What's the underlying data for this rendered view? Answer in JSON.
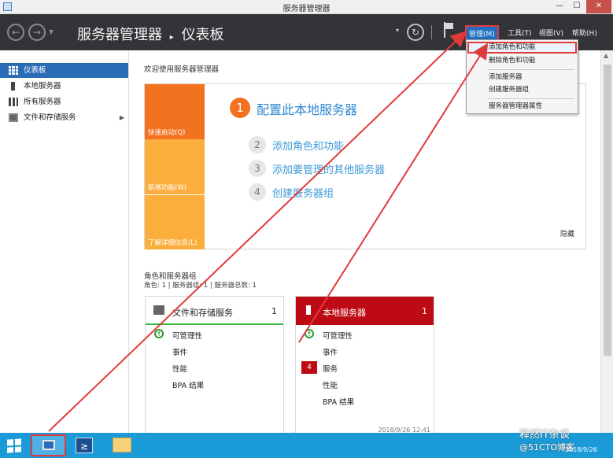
{
  "window": {
    "title": "服务器管理器",
    "minimize": "—",
    "maximize": "☐",
    "close": "✕"
  },
  "header": {
    "breadcrumb_root": "服务器管理器",
    "breadcrumb_sep": "▸",
    "breadcrumb_page": "仪表板",
    "menu": {
      "manage": "管理(M)",
      "tools": "工具(T)",
      "view": "视图(V)",
      "help": "帮助(H)"
    }
  },
  "sidebar": {
    "items": [
      {
        "label": "仪表板",
        "icon": "dashboard-icon",
        "active": true
      },
      {
        "label": "本地服务器",
        "icon": "server-icon"
      },
      {
        "label": "所有服务器",
        "icon": "servers-icon"
      },
      {
        "label": "文件和存储服务",
        "icon": "storage-icon",
        "expand": "▶"
      }
    ]
  },
  "welcome": {
    "title": "欢迎使用服务器管理器",
    "tiles": [
      "快速启动(Q)",
      "新增功能(W)",
      "了解详细信息(L)"
    ],
    "steps": [
      {
        "num": "1",
        "text": "配置此本地服务器"
      },
      {
        "num": "2",
        "text": "添加角色和功能"
      },
      {
        "num": "3",
        "text": "添加要管理的其他服务器"
      },
      {
        "num": "4",
        "text": "创建服务器组"
      }
    ],
    "hide": "隐藏"
  },
  "roles": {
    "title": "角色和服务器组",
    "subtitle": "角色: 1 | 服务器组: 1 | 服务器总数: 1",
    "cards": [
      {
        "name": "文件和存储服务",
        "count": "1",
        "rows": [
          "可管理性",
          "事件",
          "性能",
          "BPA 结果"
        ]
      },
      {
        "name": "本地服务器",
        "count": "1",
        "rows": [
          "可管理性",
          "事件",
          "服务",
          "性能",
          "BPA 结果"
        ],
        "badge": "4",
        "timestamp": "2018/9/26 12:41"
      }
    ]
  },
  "manage_menu": {
    "items": [
      "添加角色和功能",
      "删除角色和功能",
      "添加服务器",
      "创建服务器组",
      "服务器管理器属性"
    ]
  },
  "taskbar": {
    "powershell_glyph": "≥",
    "watermark": "释然IT杂谈",
    "watermark_sub": "@51CTO博客",
    "date": "2018/9/26"
  },
  "colors": {
    "accent_blue": "#2b6cb6",
    "orange": "#f2721f",
    "light_orange": "#fbae3c",
    "alert_red": "#be0a14",
    "annotation_red": "#e03b3b"
  }
}
